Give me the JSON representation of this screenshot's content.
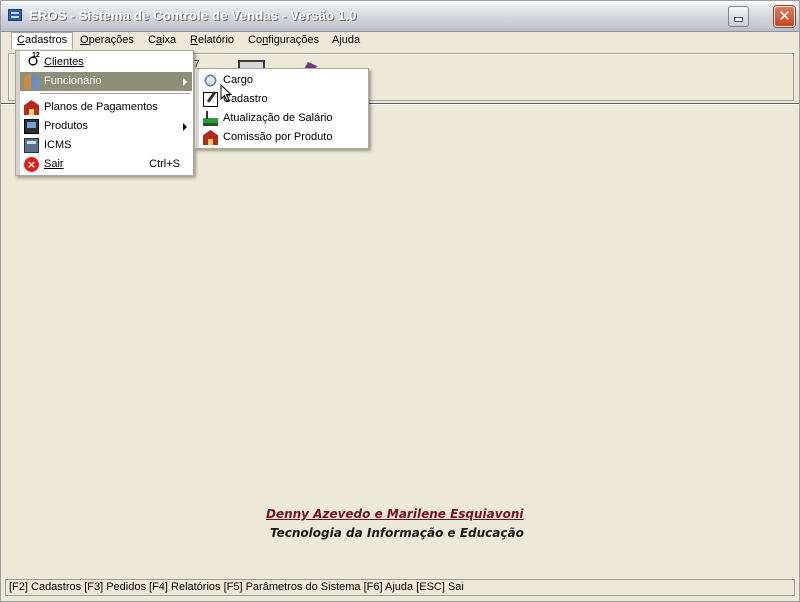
{
  "window": {
    "title": "EROS - Sistema de Controle de Vendas - Versão 1.0"
  },
  "menubar": {
    "items": [
      {
        "label": "Cadastros",
        "underline": "C"
      },
      {
        "label": "Operações",
        "underline": "O"
      },
      {
        "label": "Caixa",
        "underline": "a"
      },
      {
        "label": "Relatório",
        "underline": "R"
      },
      {
        "label": "Configurações",
        "underline": "n"
      },
      {
        "label": "Ajuda",
        "underline": ""
      }
    ]
  },
  "cadastros_menu": {
    "items": [
      {
        "label": "Clientes",
        "icon": "clients-icon"
      },
      {
        "label": "Funcionário",
        "icon": "employee-icon",
        "submenu": true,
        "highlighted": true
      },
      {
        "label": "Planos de Pagamentos",
        "icon": "house-icon"
      },
      {
        "label": "Produtos",
        "icon": "product-icon",
        "submenu": true
      },
      {
        "label": "ICMS",
        "icon": "calculator-icon"
      },
      {
        "label": "Sair",
        "icon": "exit-icon",
        "shortcut": "Ctrl+S"
      }
    ]
  },
  "funcionario_submenu": {
    "items": [
      {
        "label": "Cargo",
        "icon": "cargo-icon"
      },
      {
        "label": "Cadastro",
        "icon": "edit-icon"
      },
      {
        "label": "Atualização de Salário",
        "icon": "salary-icon"
      },
      {
        "label": "Comissão por Produto",
        "icon": "house-icon"
      }
    ]
  },
  "credits": {
    "authors": "Denny Azevedo e Marilene Esquiavoni",
    "tagline": "Tecnologia da Informação e Educação"
  },
  "statusbar": {
    "text": "[F2] Cadastros [F3] Pedidos [F4] Relatórios [F5] Parâmetros do Sistema [F6] Ajuda [ESC] Sai"
  },
  "colors": {
    "highlight": "#8d8f77",
    "credit_red": "#7a1020",
    "background": "#ece9d8"
  }
}
